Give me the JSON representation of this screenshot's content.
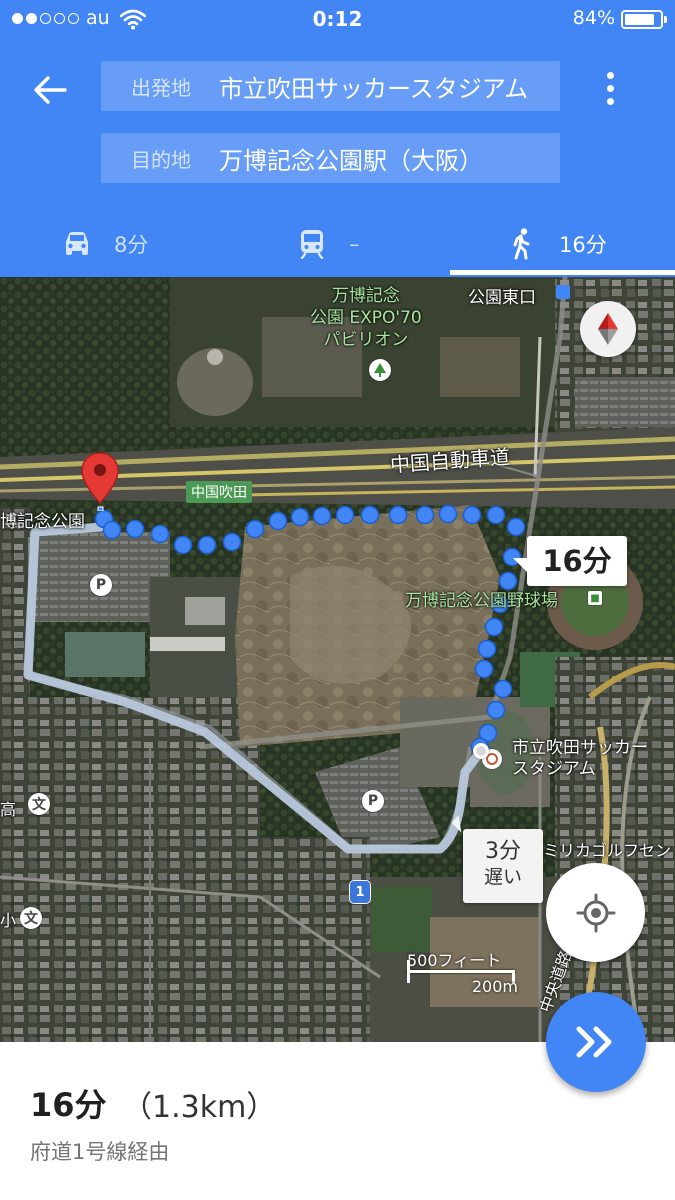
{
  "status_bar": {
    "carrier": "au",
    "time": "0:12",
    "battery_percent": "84%",
    "battery_level": 0.84,
    "signal_bars_filled": 2,
    "signal_bars_total": 5
  },
  "header": {
    "origin": {
      "label": "出発地",
      "value": "市立吹田サッカースタジアム"
    },
    "destination": {
      "label": "目的地",
      "value": "万博記念公園駅（大阪）"
    },
    "modes": [
      {
        "icon": "car-icon",
        "time": "8分"
      },
      {
        "icon": "train-icon",
        "time": "–"
      },
      {
        "icon": "walk-icon",
        "time": "16分"
      }
    ],
    "active_mode": "walk"
  },
  "map": {
    "labels": {
      "pavilion": [
        "万博記念",
        "公園 EXPO'70",
        "パビリオン"
      ],
      "park_east_exit": "公園東口",
      "expressway": "中国自動車道",
      "interchange": "中国吹田",
      "park_station": "博記念公園",
      "baseball_field": "万博記念公園野球場",
      "stadium": [
        "市立吹田サッカー",
        "スタジアム"
      ],
      "high_school": "高",
      "golf": "ミリカゴルフセン",
      "small_left": "小",
      "road_side": "中央道路"
    },
    "route_badge": "1",
    "primary_callout": "16分",
    "alternate_callout": {
      "time": "3分",
      "note": "遅い"
    },
    "scale": {
      "imperial": "500フィート",
      "metric": "200m"
    },
    "poi_icons": [
      "parking-icon",
      "parking-icon",
      "school-icon",
      "school-icon",
      "park-icon",
      "stadium-icon"
    ]
  },
  "route_summary": {
    "duration": "16分",
    "distance": "（1.3km）",
    "via": "府道1号線経由"
  },
  "colors": {
    "header_bg": "#4285f4",
    "route_dots": "#4285f4",
    "alt_route": "#b9c9dc",
    "pin": "#e53935"
  }
}
